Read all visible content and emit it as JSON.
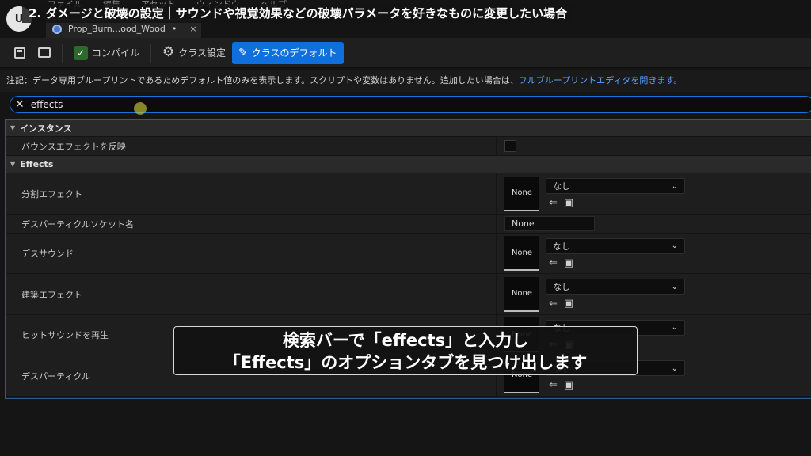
{
  "menu": [
    "ファイル",
    "編集",
    "アセット",
    "ウィンドウ",
    "ヘルプ"
  ],
  "video_title": "2. ダメージと破壊の設定｜サウンドや視覚効果などの破壊パラメータを好きなものに変更したい場合",
  "tab": {
    "label": "Prop_Burn...ood_Wood",
    "modified": "•",
    "close": "×"
  },
  "toolbar": {
    "compile": "コンパイル",
    "class_settings": "クラス設定",
    "class_defaults": "クラスのデフォルト"
  },
  "note": {
    "text": "注記：データ専用ブループリントであるためデフォルト値のみを表示します。スクリプトや変数はありません。追加したい場合は、",
    "link": "フルブループリントエディタを開きます。"
  },
  "search": {
    "value": "effects"
  },
  "categories": {
    "instance": {
      "label": "インスタンス",
      "row_label": "バウンスエフェクトを反映"
    },
    "effects": {
      "label": "Effects",
      "rows": [
        {
          "label": "分割エフェクト",
          "thumb": "None",
          "dropdown": "なし"
        },
        {
          "label": "デスパーティクルソケット名",
          "value": "None"
        },
        {
          "label": "デスサウンド",
          "thumb": "None",
          "dropdown": "なし"
        },
        {
          "label": "建築エフェクト",
          "thumb": "None",
          "dropdown": "なし"
        },
        {
          "label": "ヒットサウンドを再生",
          "thumb": "None",
          "dropdown": "なし"
        },
        {
          "label": "デスパーティクル",
          "thumb": "None",
          "dropdown": "なし"
        }
      ]
    }
  },
  "subtitle": {
    "line1": "検索バーで「effects」と入力し",
    "line2": "「Effects」のオプションタブを見つけ出します"
  }
}
